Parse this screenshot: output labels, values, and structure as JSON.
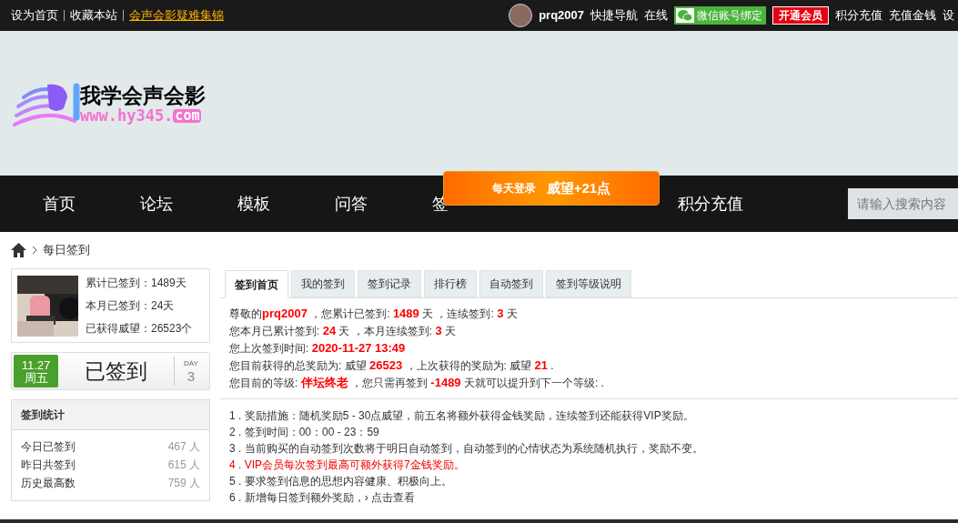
{
  "top_bar": {
    "left_links": [
      {
        "label": "设为首页",
        "kind": "plain"
      },
      {
        "label": "收藏本站",
        "kind": "plain"
      },
      {
        "label": "会声会影疑难集锦",
        "kind": "highlight"
      }
    ],
    "username": "prq2007",
    "right_links": [
      "快捷导航",
      "在线"
    ],
    "wechat_button": "微信账号绑定",
    "vip_button": "开通会员",
    "right_links_2": [
      "积分充值",
      "充值金钱",
      "设"
    ]
  },
  "logo": {
    "title": "我学会声会影",
    "url_main": "www.hy345.",
    "url_tail": "com"
  },
  "nav": {
    "items": [
      {
        "label": "首页"
      },
      {
        "label": "论坛"
      },
      {
        "label": "模板"
      },
      {
        "label": "问答"
      },
      {
        "label": "签"
      },
      {
        "label": "积分充值"
      }
    ],
    "search": {
      "placeholder": "请输入搜索内容"
    }
  },
  "popup": {
    "label": "每天登录",
    "reward": "威望+21点"
  },
  "breadcrumb": {
    "current": "每日签到"
  },
  "profile": {
    "lines": [
      "累计已签到：1489天",
      "本月已签到：24天",
      "已获得威望：26523个"
    ]
  },
  "sign_card": {
    "date": "11.27",
    "weekday": "周五",
    "status": "已签到",
    "day_label": "DAY",
    "day": "3"
  },
  "stats": {
    "title": "签到统计",
    "rows": [
      {
        "label": "今日已签到",
        "value": "467 人"
      },
      {
        "label": "昨日共签到",
        "value": "615 人"
      },
      {
        "label": "历史最高数",
        "value": "759 人"
      }
    ]
  },
  "tabs": [
    {
      "label": "签到首页",
      "selected": true
    },
    {
      "label": "我的签到",
      "selected": false
    },
    {
      "label": "签到记录",
      "selected": false
    },
    {
      "label": "排行榜",
      "selected": false
    },
    {
      "label": "自动签到",
      "selected": false
    },
    {
      "label": "签到等级说明",
      "selected": false
    }
  ],
  "summary": [
    "尊敬的**prq2007** ，您累计已签到: **1489** 天 ，连续签到: **3** 天",
    "您本月已累计签到: **24** 天 ，本月连续签到: **3** 天",
    "您上次签到时间: **2020-11-27 13:49**",
    "您目前获得的总奖励为: 威望 **26523** ，上次获得的奖励为: 威望 **21** .",
    "您目前的等级: **伴坛终老** ，您只需再签到 **-1489** 天就可以提升到下一个等级: ."
  ],
  "rules": [
    {
      "text": "1 . 奖励措施：随机奖励5 - 30点威望，前五名将额外获得金钱奖励，连续签到还能获得VIP奖励。",
      "kind": "normal"
    },
    {
      "text": "2 . 签到时间：00：00 - 23：59",
      "kind": "normal"
    },
    {
      "text": "3 . 当前购买的自动签到次数将于明日自动签到，自动签到的心情状态为系统随机执行，奖励不变。",
      "kind": "normal"
    },
    {
      "text": "4 . VIP会员每次签到最高可额外获得7金钱奖励。",
      "kind": "highlight"
    },
    {
      "text": "5 . 要求签到信息的思想内容健康、积极向上。",
      "kind": "normal"
    },
    {
      "text": "6 . 新增每日签到额外奖励，",
      "kind": "normal",
      "link": "› 点击查看"
    }
  ]
}
